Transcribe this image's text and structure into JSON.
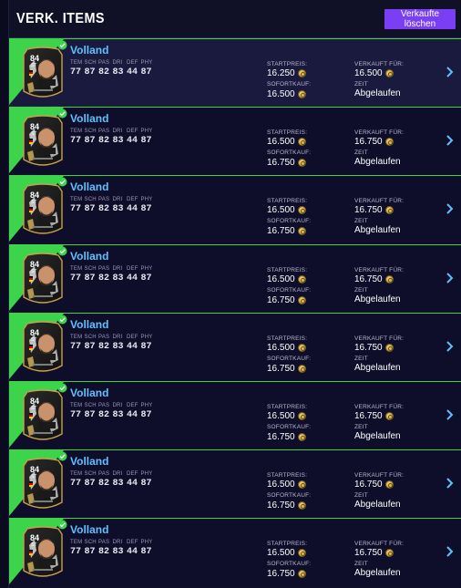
{
  "header": {
    "title": "VERK. ITEMS",
    "clear_button": "Verkaufte löschen"
  },
  "labels": {
    "stats": [
      "TEM",
      "SCH",
      "PAS",
      "DRI",
      "DEF",
      "PHY"
    ],
    "start_price": "STARTPREIS:",
    "buy_now": "SOFORTKAUF:",
    "sold_for": "VERKAUFT FÜR:",
    "time": "ZEIT"
  },
  "colors": {
    "accent_green": "#3bd44b",
    "name_blue": "#5fc0ff",
    "button_purple": "#7a3ff5"
  },
  "items": [
    {
      "name": "Volland",
      "rating": "84",
      "position": "ST",
      "stats": [
        "77",
        "87",
        "82",
        "83",
        "44",
        "87"
      ],
      "start_price": "16.250",
      "buy_now": "16.500",
      "sold_for": "16.500",
      "time": "Abgelaufen"
    },
    {
      "name": "Volland",
      "rating": "84",
      "position": "ST",
      "stats": [
        "77",
        "87",
        "82",
        "83",
        "44",
        "87"
      ],
      "start_price": "16.500",
      "buy_now": "16.750",
      "sold_for": "16.750",
      "time": "Abgelaufen"
    },
    {
      "name": "Volland",
      "rating": "84",
      "position": "ST",
      "stats": [
        "77",
        "87",
        "82",
        "83",
        "44",
        "87"
      ],
      "start_price": "16.500",
      "buy_now": "16.750",
      "sold_for": "16.750",
      "time": "Abgelaufen"
    },
    {
      "name": "Volland",
      "rating": "84",
      "position": "ST",
      "stats": [
        "77",
        "87",
        "82",
        "83",
        "44",
        "87"
      ],
      "start_price": "16.500",
      "buy_now": "16.750",
      "sold_for": "16.750",
      "time": "Abgelaufen"
    },
    {
      "name": "Volland",
      "rating": "84",
      "position": "ST",
      "stats": [
        "77",
        "87",
        "82",
        "83",
        "44",
        "87"
      ],
      "start_price": "16.500",
      "buy_now": "16.750",
      "sold_for": "16.750",
      "time": "Abgelaufen"
    },
    {
      "name": "Volland",
      "rating": "84",
      "position": "ST",
      "stats": [
        "77",
        "87",
        "82",
        "83",
        "44",
        "87"
      ],
      "start_price": "16.500",
      "buy_now": "16.750",
      "sold_for": "16.750",
      "time": "Abgelaufen"
    },
    {
      "name": "Volland",
      "rating": "84",
      "position": "ST",
      "stats": [
        "77",
        "87",
        "82",
        "83",
        "44",
        "87"
      ],
      "start_price": "16.500",
      "buy_now": "16.750",
      "sold_for": "16.750",
      "time": "Abgelaufen"
    },
    {
      "name": "Volland",
      "rating": "84",
      "position": "ST",
      "stats": [
        "77",
        "87",
        "82",
        "83",
        "44",
        "87"
      ],
      "start_price": "16.500",
      "buy_now": "16.750",
      "sold_for": "16.750",
      "time": "Abgelaufen"
    }
  ]
}
